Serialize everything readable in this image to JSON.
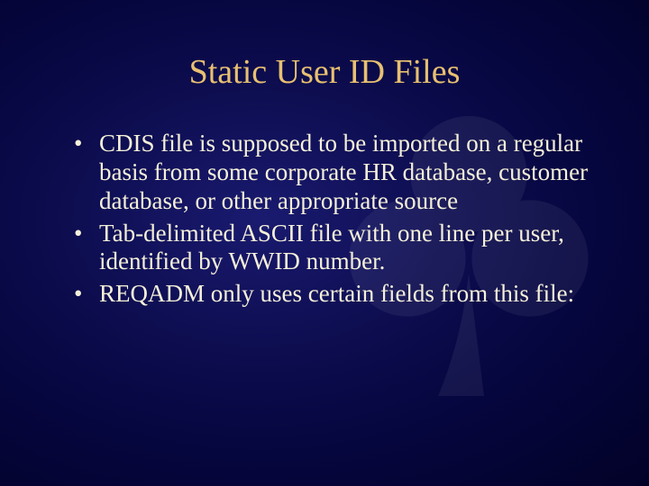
{
  "slide": {
    "title": "Static User ID Files",
    "bullets": [
      "CDIS file is supposed to be imported on a regular basis from some corporate HR database, customer database, or other appropriate source",
      "Tab-delimited ASCII file with one line per user, identified by WWID number.",
      "REQADM only uses certain fields from this file:"
    ]
  }
}
